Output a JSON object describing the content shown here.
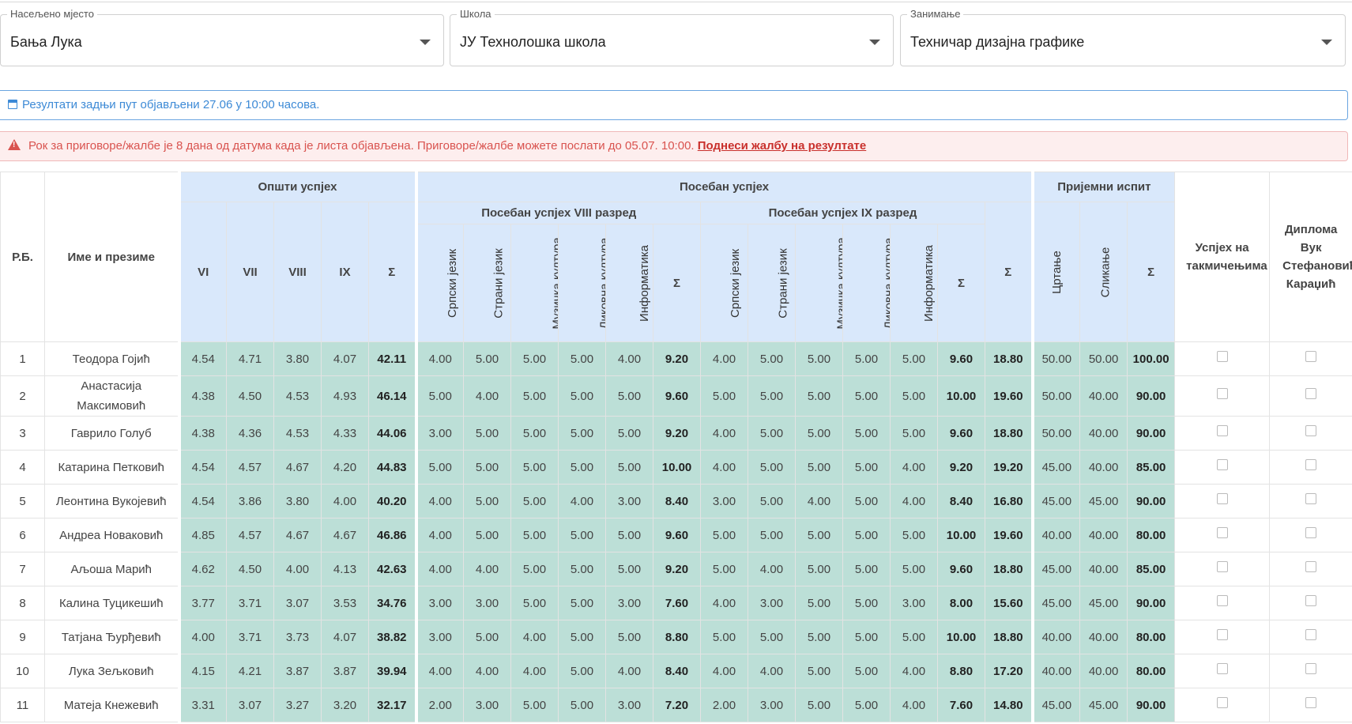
{
  "filters": [
    {
      "label": "Насељено мјесто",
      "value": "Бања Лука"
    },
    {
      "label": "Школа",
      "value": "ЈУ Технолошка школа"
    },
    {
      "label": "Занимање",
      "value": "Техничар дизајна графике"
    }
  ],
  "info_alert": "Резултати задњи пут објављени 27.06 у 10:00 часова.",
  "danger_alert": {
    "text": "Рок за приговоре/жалбе је 8 дана од датума када је листа објављена. Приговоре/жалбе можете послати до 05.07. 10:00.",
    "link": "Поднеси жалбу на резултате"
  },
  "table": {
    "rb": "Р.Б.",
    "name": "Име и презиме",
    "general": "Општи успјех",
    "general_cols": [
      "VI",
      "VII",
      "VIII",
      "IX",
      "Σ"
    ],
    "special": "Посебан успјех",
    "special_viii": "Посебан успјех VIII разред",
    "special_ix": "Посебан успјех IX разред",
    "subjects": [
      "Српски језик",
      "Страни језик",
      "Музичка култура",
      "Ликовна култура",
      "Информатика",
      "Σ"
    ],
    "special_total": "Σ",
    "entrance": "Пријемни испит",
    "entrance_cols": [
      "Цртање",
      "Сликање",
      "Σ"
    ],
    "competition": "Успјех на такмичењима",
    "diploma": "Диплома Вук Стефановић Караџић",
    "rows": [
      {
        "rb": "1",
        "name": "Теодора Гојић",
        "g": [
          "4.54",
          "4.71",
          "3.80",
          "4.07",
          "42.11"
        ],
        "s8": [
          "4.00",
          "5.00",
          "5.00",
          "5.00",
          "4.00",
          "9.20"
        ],
        "s9": [
          "4.00",
          "5.00",
          "5.00",
          "5.00",
          "5.00",
          "9.60"
        ],
        "st": "18.80",
        "e": [
          "50.00",
          "50.00",
          "100.00"
        ]
      },
      {
        "rb": "2",
        "name": "Анастасија Максимовић",
        "g": [
          "4.38",
          "4.50",
          "4.53",
          "4.93",
          "46.14"
        ],
        "s8": [
          "5.00",
          "4.00",
          "5.00",
          "5.00",
          "5.00",
          "9.60"
        ],
        "s9": [
          "5.00",
          "5.00",
          "5.00",
          "5.00",
          "5.00",
          "10.00"
        ],
        "st": "19.60",
        "e": [
          "50.00",
          "40.00",
          "90.00"
        ]
      },
      {
        "rb": "3",
        "name": "Гаврило Голуб",
        "g": [
          "4.38",
          "4.36",
          "4.53",
          "4.33",
          "44.06"
        ],
        "s8": [
          "3.00",
          "5.00",
          "5.00",
          "5.00",
          "5.00",
          "9.20"
        ],
        "s9": [
          "4.00",
          "5.00",
          "5.00",
          "5.00",
          "5.00",
          "9.60"
        ],
        "st": "18.80",
        "e": [
          "50.00",
          "40.00",
          "90.00"
        ]
      },
      {
        "rb": "4",
        "name": "Катарина Петковић",
        "g": [
          "4.54",
          "4.57",
          "4.67",
          "4.20",
          "44.83"
        ],
        "s8": [
          "5.00",
          "5.00",
          "5.00",
          "5.00",
          "5.00",
          "10.00"
        ],
        "s9": [
          "4.00",
          "5.00",
          "5.00",
          "5.00",
          "4.00",
          "9.20"
        ],
        "st": "19.20",
        "e": [
          "45.00",
          "40.00",
          "85.00"
        ]
      },
      {
        "rb": "5",
        "name": "Леонтина Вукојевић",
        "g": [
          "4.54",
          "3.86",
          "3.80",
          "4.00",
          "40.20"
        ],
        "s8": [
          "4.00",
          "5.00",
          "5.00",
          "4.00",
          "3.00",
          "8.40"
        ],
        "s9": [
          "3.00",
          "5.00",
          "4.00",
          "5.00",
          "4.00",
          "8.40"
        ],
        "st": "16.80",
        "e": [
          "45.00",
          "45.00",
          "90.00"
        ]
      },
      {
        "rb": "6",
        "name": "Андреа Новаковић",
        "g": [
          "4.85",
          "4.57",
          "4.67",
          "4.67",
          "46.86"
        ],
        "s8": [
          "4.00",
          "5.00",
          "5.00",
          "5.00",
          "5.00",
          "9.60"
        ],
        "s9": [
          "5.00",
          "5.00",
          "5.00",
          "5.00",
          "5.00",
          "10.00"
        ],
        "st": "19.60",
        "e": [
          "40.00",
          "40.00",
          "80.00"
        ]
      },
      {
        "rb": "7",
        "name": "Аљоша Марић",
        "g": [
          "4.62",
          "4.50",
          "4.00",
          "4.13",
          "42.63"
        ],
        "s8": [
          "4.00",
          "4.00",
          "5.00",
          "5.00",
          "5.00",
          "9.20"
        ],
        "s9": [
          "5.00",
          "4.00",
          "5.00",
          "5.00",
          "5.00",
          "9.60"
        ],
        "st": "18.80",
        "e": [
          "45.00",
          "40.00",
          "85.00"
        ]
      },
      {
        "rb": "8",
        "name": "Калина Туцикешић",
        "g": [
          "3.77",
          "3.71",
          "3.07",
          "3.53",
          "34.76"
        ],
        "s8": [
          "3.00",
          "3.00",
          "5.00",
          "5.00",
          "3.00",
          "7.60"
        ],
        "s9": [
          "4.00",
          "3.00",
          "5.00",
          "5.00",
          "3.00",
          "8.00"
        ],
        "st": "15.60",
        "e": [
          "45.00",
          "45.00",
          "90.00"
        ]
      },
      {
        "rb": "9",
        "name": "Татјана Ђурђевић",
        "g": [
          "4.00",
          "3.71",
          "3.73",
          "4.07",
          "38.82"
        ],
        "s8": [
          "3.00",
          "5.00",
          "4.00",
          "5.00",
          "5.00",
          "8.80"
        ],
        "s9": [
          "5.00",
          "5.00",
          "5.00",
          "5.00",
          "5.00",
          "10.00"
        ],
        "st": "18.80",
        "e": [
          "40.00",
          "40.00",
          "80.00"
        ]
      },
      {
        "rb": "10",
        "name": "Лука Зељковић",
        "g": [
          "4.15",
          "4.21",
          "3.87",
          "3.87",
          "39.94"
        ],
        "s8": [
          "4.00",
          "4.00",
          "4.00",
          "5.00",
          "4.00",
          "8.40"
        ],
        "s9": [
          "4.00",
          "4.00",
          "5.00",
          "5.00",
          "4.00",
          "8.80"
        ],
        "st": "17.20",
        "e": [
          "40.00",
          "40.00",
          "80.00"
        ]
      },
      {
        "rb": "11",
        "name": "Матеја Кнежевић",
        "g": [
          "3.31",
          "3.07",
          "3.27",
          "3.20",
          "32.17"
        ],
        "s8": [
          "2.00",
          "3.00",
          "5.00",
          "5.00",
          "3.00",
          "7.20"
        ],
        "s9": [
          "2.00",
          "3.00",
          "5.00",
          "5.00",
          "4.00",
          "7.60"
        ],
        "st": "14.80",
        "e": [
          "45.00",
          "45.00",
          "90.00"
        ]
      }
    ]
  }
}
